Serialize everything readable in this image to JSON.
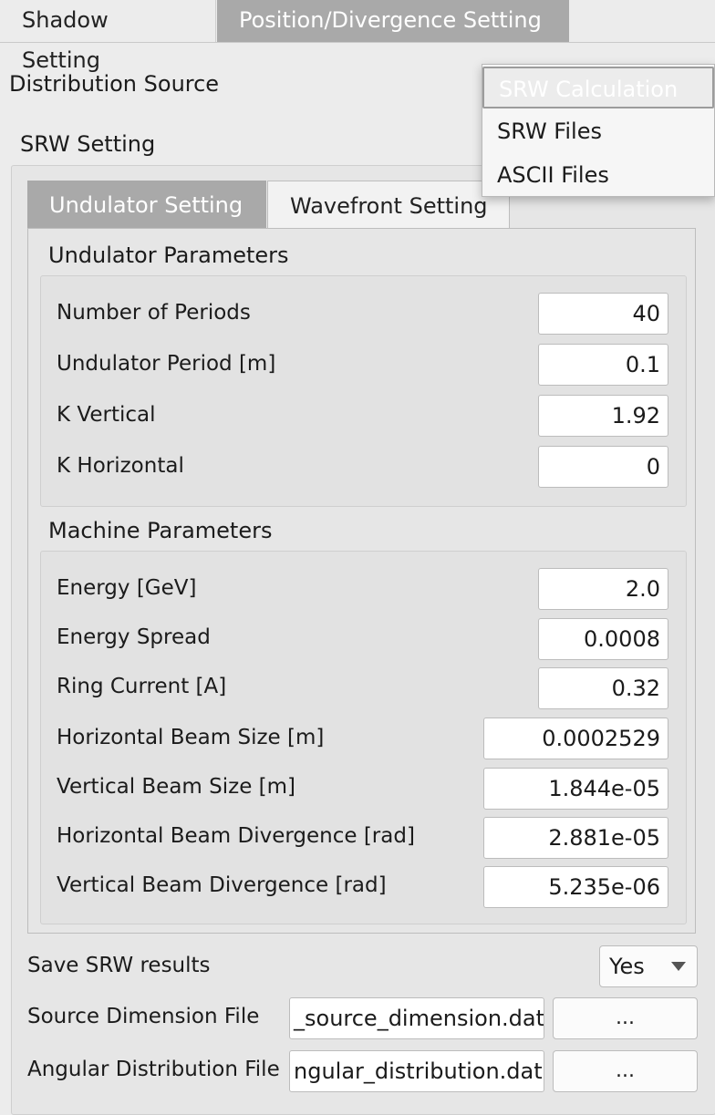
{
  "tabs": {
    "shadow": "Shadow Setting",
    "position": "Position/Divergence Setting"
  },
  "distribution": {
    "label": "Distribution Source",
    "options": [
      "SRW Calculation",
      "SRW Files",
      "ASCII Files"
    ],
    "selected": "SRW Calculation"
  },
  "srw": {
    "group_label": "SRW Setting",
    "subtabs": {
      "undulator": "Undulator Setting",
      "wavefront": "Wavefront Setting"
    },
    "undulator_params": {
      "title": "Undulator Parameters",
      "fields": [
        {
          "label": "Number of Periods",
          "value": "40"
        },
        {
          "label": "Undulator Period [m]",
          "value": "0.1"
        },
        {
          "label": "K Vertical",
          "value": "1.92"
        },
        {
          "label": "K Horizontal",
          "value": "0"
        }
      ]
    },
    "machine_params": {
      "title": "Machine Parameters",
      "fields": [
        {
          "label": "Energy [GeV]",
          "value": "2.0"
        },
        {
          "label": "Energy Spread",
          "value": "0.0008"
        },
        {
          "label": "Ring Current [A]",
          "value": "0.32"
        },
        {
          "label": "Horizontal Beam Size [m]",
          "value": "0.0002529"
        },
        {
          "label": "Vertical Beam Size [m]",
          "value": "1.844e-05"
        },
        {
          "label": "Horizontal Beam Divergence [rad]",
          "value": "2.881e-05"
        },
        {
          "label": "Vertical Beam Divergence [rad]",
          "value": "5.235e-06"
        }
      ]
    }
  },
  "save": {
    "label": "Save SRW results",
    "value": "Yes"
  },
  "files": {
    "source_dimension": {
      "label": "Source Dimension File",
      "value": "_source_dimension.dat",
      "browse": "..."
    },
    "angular_distribution": {
      "label": "Angular Distribution File",
      "value": "ngular_distribution.dat",
      "browse": "..."
    }
  }
}
